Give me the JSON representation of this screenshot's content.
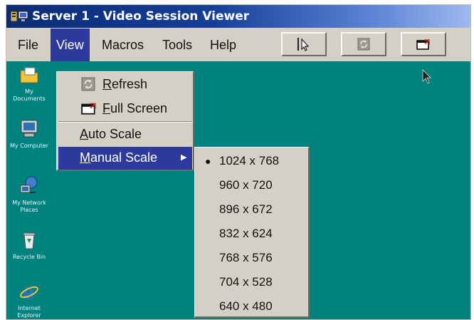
{
  "titlebar": {
    "title": "Server 1 - Video Session Viewer",
    "icon": "server-app-icon"
  },
  "menubar": {
    "items": [
      "File",
      "View",
      "Macros",
      "Tools",
      "Help"
    ],
    "active": "View",
    "toolbar": [
      "pointer-align-icon",
      "refresh-icon",
      "full-screen-icon"
    ]
  },
  "view_menu": {
    "refresh": {
      "icon": "refresh-icon",
      "label": "Refresh"
    },
    "full_screen": {
      "icon": "full-screen-icon",
      "label": "Full Screen"
    },
    "auto_scale": {
      "label": "Auto Scale"
    },
    "manual_scale": {
      "label": "Manual Scale",
      "submenu_arrow": "▶"
    }
  },
  "manual_scale_menu": {
    "selected": "1024 x 768",
    "bullet": "●",
    "options": [
      "1024 x 768",
      "960 x 720",
      "896 x 672",
      "832 x 624",
      "768 x 576",
      "704 x 528",
      "640 x 480"
    ]
  },
  "desktop": {
    "background": "#00837e",
    "icons": [
      {
        "icon": "my-documents-icon",
        "label": "My Documents"
      },
      {
        "icon": "my-computer-icon",
        "label": "My Computer"
      },
      {
        "icon": "my-network-places-icon",
        "label": "My Network Places"
      },
      {
        "icon": "recycle-bin-icon",
        "label": "Recycle Bin"
      },
      {
        "icon": "internet-explorer-icon",
        "label": "Internet Explorer"
      }
    ]
  },
  "colors": {
    "menu_highlight": "#2d3a9b",
    "menu_bg": "#d5d0c5",
    "title_start": "#0b2b74",
    "title_end": "#9fb9ee"
  }
}
